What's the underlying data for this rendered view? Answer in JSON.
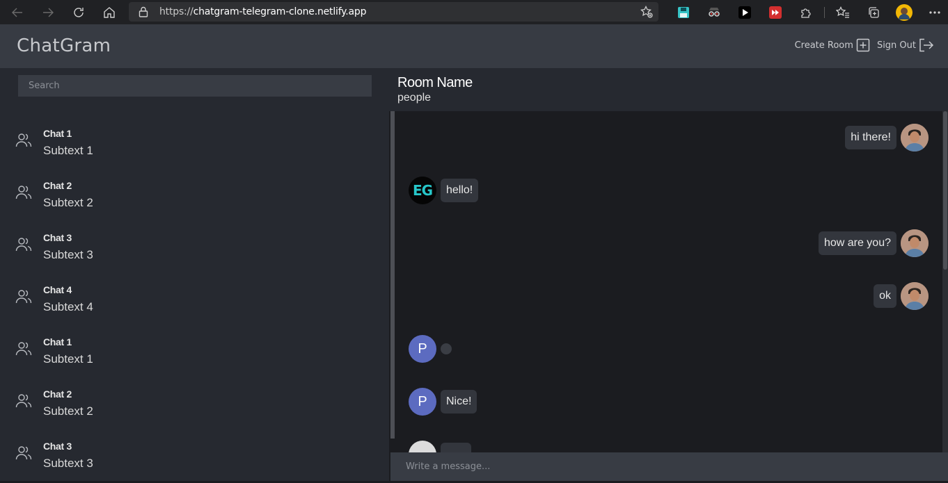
{
  "browser": {
    "url_scheme": "https://",
    "url_host": "chatgram-telegram-clone.netlify.app",
    "extensions": [
      "save-extension-icon",
      "spy-extension-icon",
      "play-extension-icon",
      "red-play-extension-icon",
      "puzzle-extensions-icon"
    ],
    "toolbar_icons": [
      "favorites-icon",
      "collections-icon",
      "profile-avatar",
      "more-menu-icon"
    ]
  },
  "app": {
    "title": "ChatGram",
    "create_room_label": "Create Room",
    "sign_out_label": "Sign Out"
  },
  "sidebar": {
    "search_placeholder": "Search",
    "chats": [
      {
        "name": "Chat 1",
        "subtext": "Subtext 1"
      },
      {
        "name": "Chat 2",
        "subtext": "Subtext 2"
      },
      {
        "name": "Chat 3",
        "subtext": "Subtext 3"
      },
      {
        "name": "Chat 4",
        "subtext": "Subtext 4"
      },
      {
        "name": "Chat 1",
        "subtext": "Subtext 1"
      },
      {
        "name": "Chat 2",
        "subtext": "Subtext 2"
      },
      {
        "name": "Chat 3",
        "subtext": "Subtext 3"
      }
    ]
  },
  "room": {
    "name": "Room Name",
    "subtitle": "people"
  },
  "messages": [
    {
      "direction": "outgoing",
      "text": "hi there!",
      "avatar": "photo"
    },
    {
      "direction": "incoming",
      "text": "hello!",
      "avatar": "EG"
    },
    {
      "direction": "outgoing",
      "text": "how are you?",
      "avatar": "photo"
    },
    {
      "direction": "outgoing",
      "text": "ok",
      "avatar": "photo"
    },
    {
      "direction": "incoming",
      "text": "",
      "avatar": "P"
    },
    {
      "direction": "incoming",
      "text": "Nice!",
      "avatar": "P"
    },
    {
      "direction": "incoming",
      "text": "",
      "avatar": "ghost"
    }
  ],
  "composer": {
    "placeholder": "Write a message..."
  },
  "colors": {
    "header_bg": "#373b43",
    "sidebar_bg": "#262930",
    "messages_bg": "#1b1c20",
    "bubble_bg": "#33363d",
    "letter_avatar": "#5c6bc0",
    "eg_accent": "#27c6c9"
  }
}
